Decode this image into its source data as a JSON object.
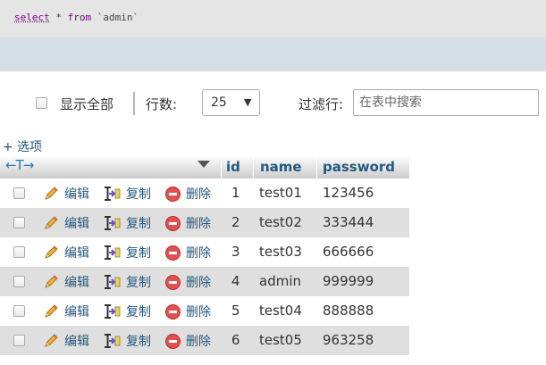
{
  "sql": {
    "select_kw": "select",
    "star": "*",
    "from_kw": "from",
    "table": "`admin`"
  },
  "controls": {
    "show_all_label": "显示全部",
    "rows_label": "行数:",
    "rows_value": "25",
    "rows_arrow": "▼",
    "filter_label": "过滤行:",
    "filter_placeholder": "在表中搜索"
  },
  "options_link": "+ 选项",
  "table": {
    "nav_arrows": "←T→",
    "columns": [
      "id",
      "name",
      "password"
    ],
    "actions": {
      "edit": "编辑",
      "copy": "复制",
      "delete": "删除"
    },
    "rows": [
      {
        "id": "1",
        "name": "test01",
        "password": "123456"
      },
      {
        "id": "2",
        "name": "test02",
        "password": "333444"
      },
      {
        "id": "3",
        "name": "test03",
        "password": "666666"
      },
      {
        "id": "4",
        "name": "admin",
        "password": "999999"
      },
      {
        "id": "5",
        "name": "test04",
        "password": "888888"
      },
      {
        "id": "6",
        "name": "test05",
        "password": "963258"
      }
    ]
  },
  "colors": {
    "link": "#235a81",
    "row_alt": "#dfdfdf",
    "sql_keyword": "#770088",
    "delete_icon": "#e05050"
  }
}
